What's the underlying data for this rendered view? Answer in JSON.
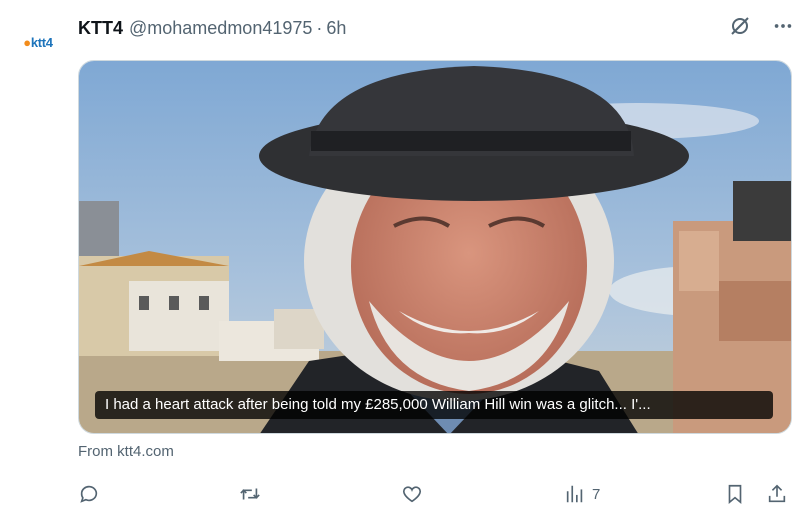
{
  "tweet": {
    "avatar": {
      "logo_text": "ktt4"
    },
    "author": {
      "name": "KTT4",
      "handle": "@mohamedmon41975",
      "separator": "·",
      "time": "6h"
    },
    "header_icons": [
      "grok-slash-icon",
      "more-icon"
    ],
    "card": {
      "caption": "I had a heart attack after being told my £285,000 William Hill win was a glitch... I'...",
      "source": "From ktt4.com"
    },
    "actions": {
      "reply_count": "",
      "retweet_count": "",
      "like_count": "",
      "views_count": "7"
    }
  }
}
